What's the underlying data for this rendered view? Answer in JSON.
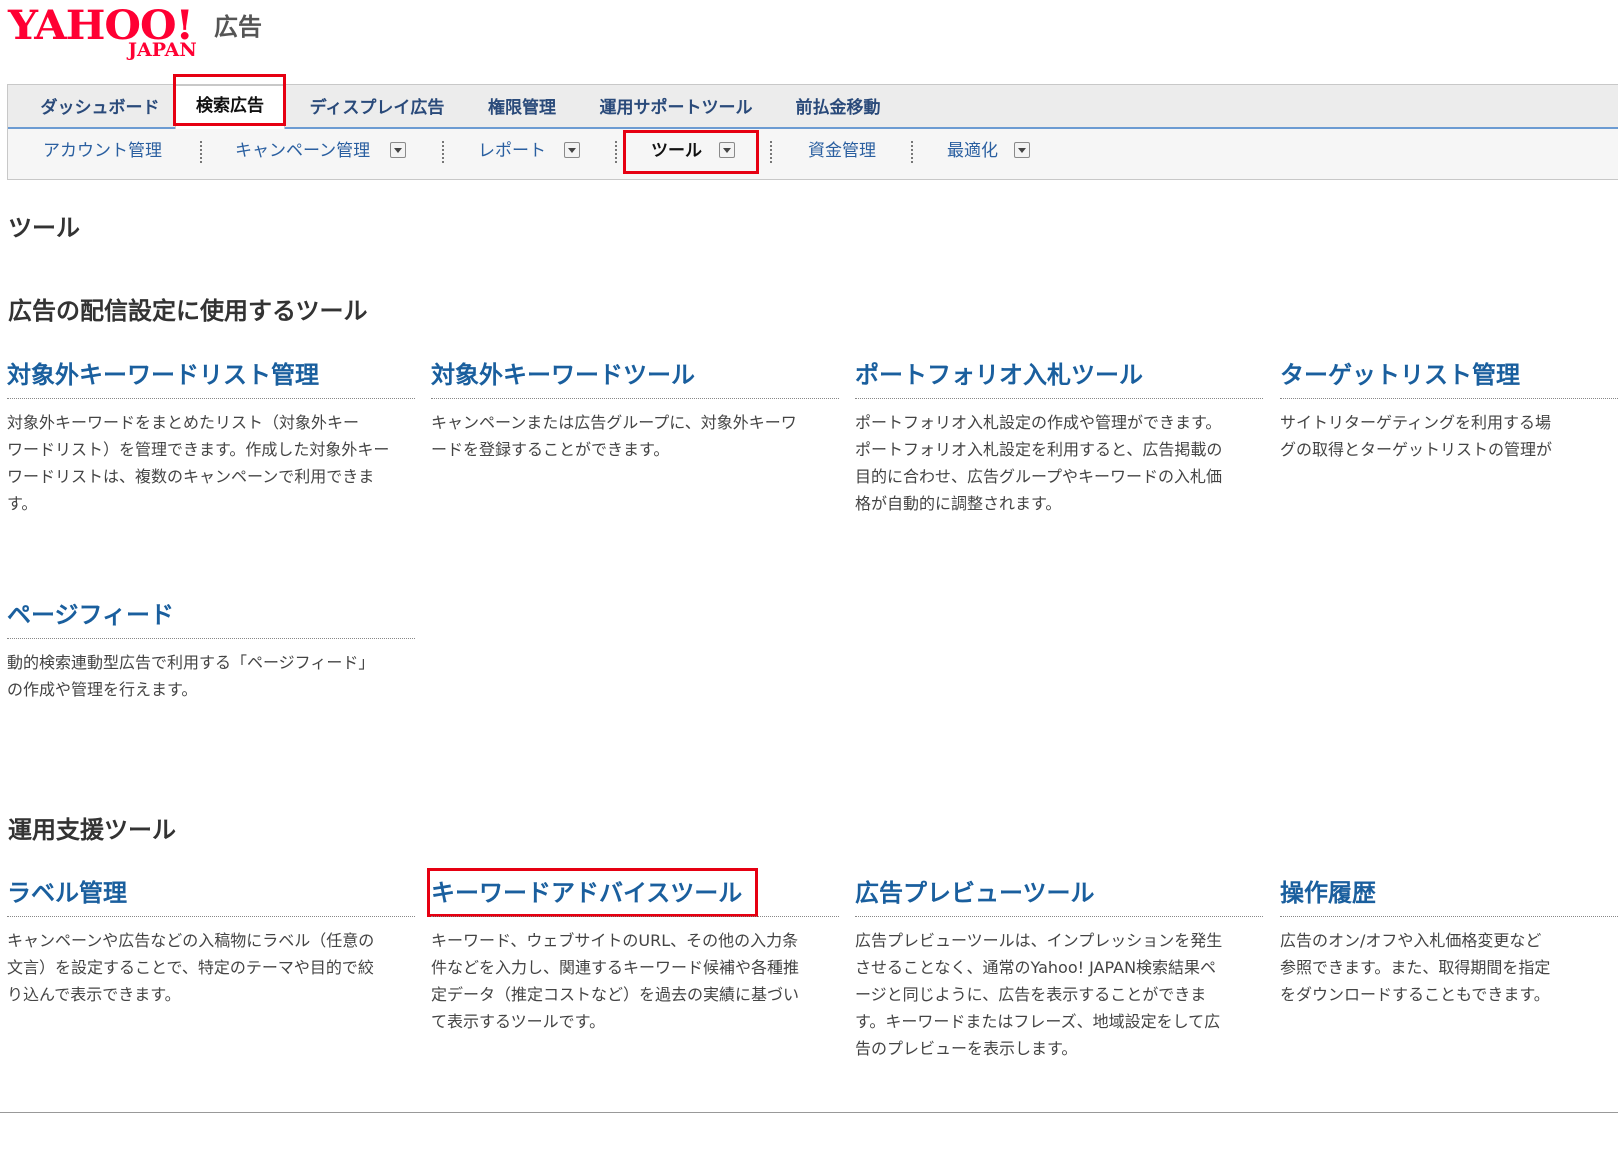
{
  "logo": {
    "yahoo": "YAHOO!",
    "japan": "JAPAN",
    "product": "広告"
  },
  "main_tabs": [
    {
      "label": "ダッシュボード",
      "active": false
    },
    {
      "label": "検索広告",
      "active": true
    },
    {
      "label": "ディスプレイ広告",
      "active": false
    },
    {
      "label": "権限管理",
      "active": false
    },
    {
      "label": "運用サポートツール",
      "active": false
    },
    {
      "label": "前払金移動",
      "active": false
    }
  ],
  "sub_menu": [
    {
      "label": "アカウント管理",
      "dropdown": false,
      "active": false
    },
    {
      "label": "キャンペーン管理",
      "dropdown": true,
      "active": false
    },
    {
      "label": "レポート",
      "dropdown": true,
      "active": false
    },
    {
      "label": "ツール",
      "dropdown": true,
      "active": true
    },
    {
      "label": "資金管理",
      "dropdown": false,
      "active": false
    },
    {
      "label": "最適化",
      "dropdown": true,
      "active": false
    }
  ],
  "page_title": "ツール",
  "sections": [
    {
      "title": "広告の配信設定に使用するツール",
      "tools": [
        {
          "title": "対象外キーワードリスト管理",
          "desc": "対象外キーワードをまとめたリスト（対象外キー\nワードリスト）を管理できます。作成した対象外キー\nワードリストは、複数のキャンペーンで利用できま\nす。"
        },
        {
          "title": "対象外キーワードツール",
          "desc": "キャンペーンまたは広告グループに、対象外キーワ\nードを登録することができます。"
        },
        {
          "title": "ポートフォリオ入札ツール",
          "desc": "ポートフォリオ入札設定の作成や管理ができます。\nポートフォリオ入札設定を利用すると、広告掲載の\n目的に合わせ、広告グループやキーワードの入札価\n格が自動的に調整されます。"
        },
        {
          "title": "ターゲットリスト管理",
          "desc": "サイトリターゲティングを利用する場\nグの取得とターゲットリストの管理が"
        },
        {
          "title": "ページフィード",
          "desc": "動的検索連動型広告で利用する「ページフィード」\nの作成や管理を行えます。"
        }
      ]
    },
    {
      "title": "運用支援ツール",
      "tools": [
        {
          "title": "ラベル管理",
          "desc": "キャンペーンや広告などの入稿物にラベル（任意の\n文言）を設定することで、特定のテーマや目的で絞\nり込んで表示できます。"
        },
        {
          "title": "キーワードアドバイスツール",
          "desc": "キーワード、ウェブサイトのURL、その他の入力条\n件などを入力し、関連するキーワード候補や各種推\n定データ（推定コストなど）を過去の実績に基づい\nて表示するツールです。"
        },
        {
          "title": "広告プレビューツール",
          "desc": "広告プレビューツールは、インプレッションを発生\nさせることなく、通常のYahoo! JAPAN検索結果ペ\nージと同じように、広告を表示することができま\nす。キーワードまたはフレーズ、地域設定をして広\n告のプレビューを表示します。"
        },
        {
          "title": "操作履歴",
          "desc": "広告のオン/オフや入札価格変更など\n参照できます。また、取得期間を指定\nをダウンロードすることもできます。"
        }
      ]
    }
  ],
  "colors": {
    "highlight": "#e60012",
    "link": "#1a5f9e",
    "logo": "#ff0033"
  }
}
